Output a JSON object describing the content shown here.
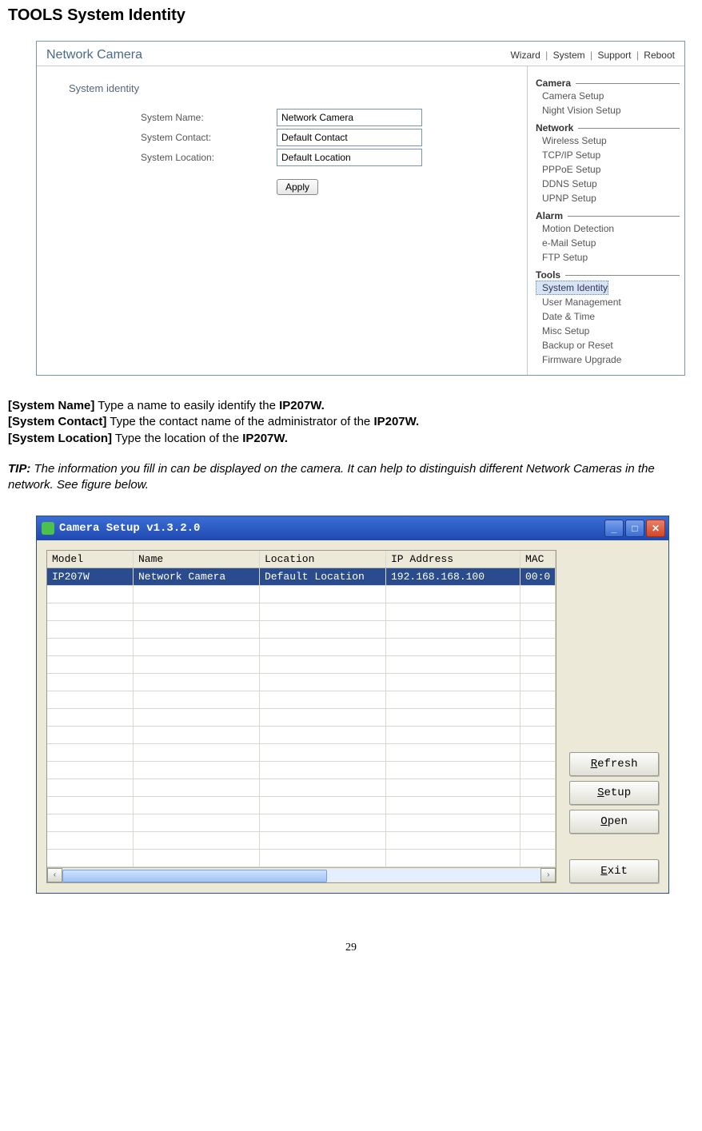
{
  "page": {
    "title": "TOOLS System Identity",
    "number": "29"
  },
  "panel1": {
    "brand": "Network Camera",
    "topLinks": [
      "Wizard",
      "System",
      "Support",
      "Reboot"
    ],
    "section": "System identity",
    "fields": {
      "name": {
        "label": "System Name:",
        "value": "Network Camera"
      },
      "contact": {
        "label": "System Contact:",
        "value": "Default Contact"
      },
      "location": {
        "label": "System Location:",
        "value": "Default Location"
      }
    },
    "applyLabel": "Apply",
    "sidebar": {
      "groups": [
        {
          "title": "Camera",
          "items": [
            "Camera Setup",
            "Night Vision Setup"
          ]
        },
        {
          "title": "Network",
          "items": [
            "Wireless Setup",
            "TCP/IP Setup",
            "PPPoE Setup",
            "DDNS Setup",
            "UPNP Setup"
          ]
        },
        {
          "title": "Alarm",
          "items": [
            "Motion Detection",
            "e-Mail Setup",
            "FTP Setup"
          ]
        },
        {
          "title": "Tools",
          "items": [
            "System Identity",
            "User Management",
            "Date & Time",
            "Misc Setup",
            "Backup or Reset",
            "Firmware Upgrade"
          ],
          "selectedIndex": 0
        }
      ]
    }
  },
  "descriptions": {
    "systemName": {
      "label": "[System Name]",
      "text": " Type a name to easily identify the ",
      "bold": "IP207W."
    },
    "systemContact": {
      "label": "[System Contact]",
      "text": " Type the contact name of the administrator of the ",
      "bold": "IP207W."
    },
    "systemLocation": {
      "label": "[System Location]",
      "text": " Type the location of the ",
      "bold": "IP207W."
    }
  },
  "tip": {
    "label": "TIP:",
    "text": " The information you fill in can be displayed on the camera. It can help to distinguish different Network Cameras in the network. See figure below."
  },
  "win": {
    "title": "Camera Setup v1.3.2.0",
    "columns": [
      "Model",
      "Name",
      "Location",
      "IP Address",
      "MAC"
    ],
    "row": {
      "model": "IP207W",
      "name": "Network Camera",
      "location": "Default Location",
      "ip": "192.168.168.100",
      "mac": "00:0"
    },
    "buttons": {
      "refresh": "Refresh",
      "setup": "Setup",
      "open": "Open",
      "exit": "Exit"
    }
  }
}
